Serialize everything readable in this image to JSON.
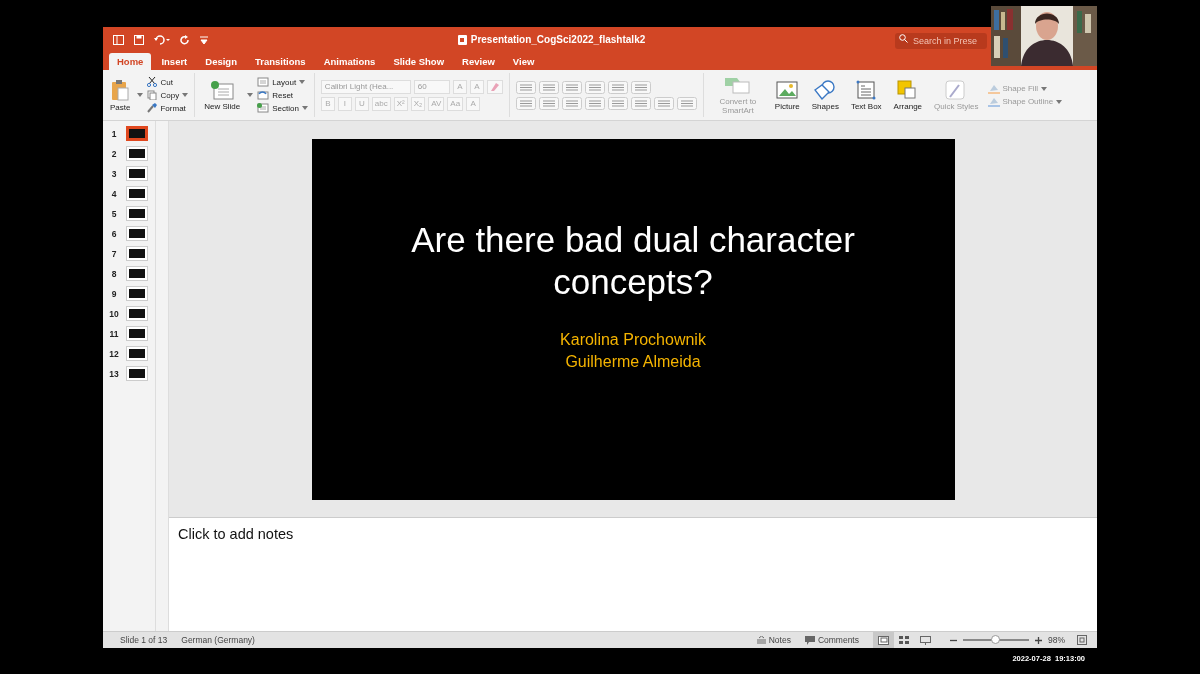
{
  "title_bar": {
    "title": "Presentation_CogSci2022_flashtalk2",
    "search": {
      "placeholder": "Search in Prese"
    }
  },
  "tabs": [
    {
      "label": "Home",
      "selected": true
    },
    {
      "label": "Insert",
      "selected": false
    },
    {
      "label": "Design",
      "selected": false
    },
    {
      "label": "Transitions",
      "selected": false
    },
    {
      "label": "Animations",
      "selected": false
    },
    {
      "label": "Slide Show",
      "selected": false
    },
    {
      "label": "Review",
      "selected": false
    },
    {
      "label": "View",
      "selected": false
    }
  ],
  "ribbon": {
    "paste": "Paste",
    "clipboard": [
      "Cut",
      "Copy",
      "Format"
    ],
    "new_slide": "New Slide",
    "slide_items": [
      "Layout",
      "Reset",
      "Section"
    ],
    "font": {
      "name": "Calibri Light (Hea...",
      "size": "60",
      "size_buttons": [
        "A",
        "A"
      ],
      "style_buttons": [
        "B",
        "I",
        "U",
        "abc",
        "X²",
        "X₂",
        "AV",
        "Aa",
        "A"
      ]
    },
    "big_buttons": [
      {
        "label": "Convert to SmartArt",
        "kind": "smartart",
        "disabled": true
      },
      {
        "label": "Picture",
        "kind": "picture",
        "disabled": false
      },
      {
        "label": "Shapes",
        "kind": "shapes",
        "disabled": false
      },
      {
        "label": "Text Box",
        "kind": "textbox",
        "disabled": false
      },
      {
        "label": "Arrange",
        "kind": "arrange",
        "disabled": false
      },
      {
        "label": "Quick Styles",
        "kind": "styles",
        "disabled": true
      }
    ],
    "shape_items": [
      "Shape Fill",
      "Shape Outline"
    ]
  },
  "thumbnails": [
    {
      "number": "1",
      "selected": true
    },
    {
      "number": "2",
      "selected": false
    },
    {
      "number": "3",
      "selected": false
    },
    {
      "number": "4",
      "selected": false
    },
    {
      "number": "5",
      "selected": false
    },
    {
      "number": "6",
      "selected": false
    },
    {
      "number": "7",
      "selected": false
    },
    {
      "number": "8",
      "selected": false
    },
    {
      "number": "9",
      "selected": false
    },
    {
      "number": "10",
      "selected": false
    },
    {
      "number": "11",
      "selected": false
    },
    {
      "number": "12",
      "selected": false
    },
    {
      "number": "13",
      "selected": false
    }
  ],
  "slide": {
    "title": "Are there bad dual character concepts?",
    "authors": [
      "Karolina Prochownik",
      "Guilherme Almeida"
    ]
  },
  "notes": {
    "placeholder": "Click to add notes"
  },
  "status_bar": {
    "slide_info": "Slide 1 of 13",
    "language": "German (Germany)",
    "notes": "Notes",
    "comments": "Comments",
    "views": [
      {
        "kind": "normal",
        "selected": true
      },
      {
        "kind": "sorter",
        "selected": false
      },
      {
        "kind": "presenter",
        "selected": false
      }
    ],
    "zoom": {
      "level": 0.5
    },
    "zoom_value": "98%"
  },
  "timestamp": "2022-07-28  19:13:00"
}
